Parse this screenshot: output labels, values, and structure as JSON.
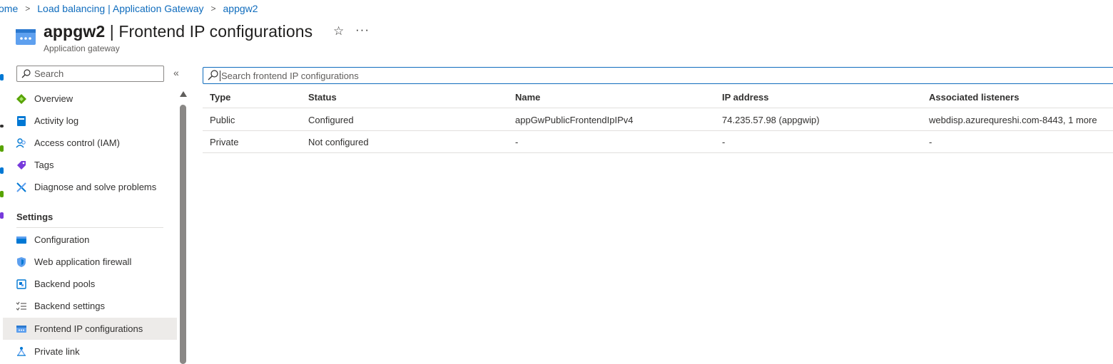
{
  "breadcrumb": {
    "items": [
      "Home",
      "Load balancing | Application Gateway",
      "appgw2"
    ],
    "visible_first": "ome"
  },
  "header": {
    "resource_name": "appgw2",
    "page_name": "Frontend IP configurations",
    "separator": "|",
    "subtitle": "Application gateway",
    "star_icon": "star-icon",
    "more_icon": "ellipsis-icon"
  },
  "sidebar": {
    "search_placeholder": "Search",
    "collapse_icon": "double-chevron-left-icon",
    "items": [
      {
        "label": "Overview",
        "icon": "overview-icon",
        "color": "#57a300"
      },
      {
        "label": "Activity log",
        "icon": "activity-log-icon",
        "color": "#0078d4"
      },
      {
        "label": "Access control (IAM)",
        "icon": "iam-icon",
        "color": "#0078d4"
      },
      {
        "label": "Tags",
        "icon": "tag-icon",
        "color": "#773adc"
      },
      {
        "label": "Diagnose and solve problems",
        "icon": "wrench-icon",
        "color": "#0078d4"
      }
    ],
    "section_title": "Settings",
    "settings_items": [
      {
        "label": "Configuration",
        "icon": "configuration-icon",
        "color": "#0078d4"
      },
      {
        "label": "Web application firewall",
        "icon": "shield-icon",
        "color": "#5ea0ef"
      },
      {
        "label": "Backend pools",
        "icon": "backend-pools-icon",
        "color": "#0078d4"
      },
      {
        "label": "Backend settings",
        "icon": "list-settings-icon",
        "color": "#0078d4"
      },
      {
        "label": "Frontend IP configurations",
        "icon": "frontend-ip-icon",
        "color": "#0078d4",
        "selected": true
      },
      {
        "label": "Private link",
        "icon": "private-link-icon",
        "color": "#0078d4"
      }
    ]
  },
  "main": {
    "search_placeholder": "Search frontend IP configurations",
    "columns": [
      "Type",
      "Status",
      "Name",
      "IP address",
      "Associated listeners"
    ],
    "rows": [
      [
        "Public",
        "Configured",
        "appGwPublicFrontendIpIPv4",
        "74.235.57.98 (appgwip)",
        "webdisp.azurequreshi.com-8443, 1 more"
      ],
      [
        "Private",
        "Not configured",
        "-",
        "-",
        "-"
      ]
    ]
  },
  "colors": {
    "accent": "#0f6cbd",
    "selected_bg": "#edebe9",
    "divider": "#e1dfdd"
  }
}
